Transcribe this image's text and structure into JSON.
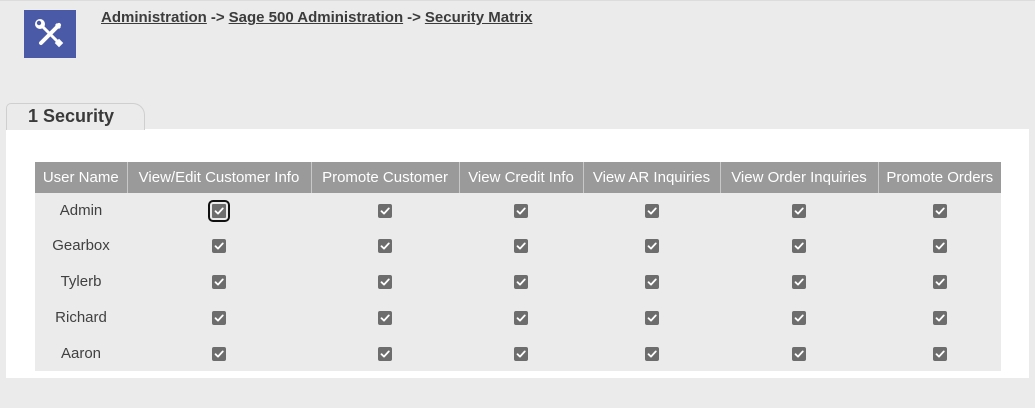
{
  "breadcrumb": {
    "item1": "Administration",
    "sep1": "->",
    "item2": "Sage 500 Administration",
    "sep2": "->",
    "item3": "Security Matrix"
  },
  "tab": {
    "label": "1 Security"
  },
  "icons": {
    "app": "wrench-screwdriver-icon",
    "check": "checkbox-checked-icon"
  },
  "colors": {
    "header": "#9a9a9a",
    "accent": "#4a5aa6",
    "checkbox": "#6d6d6d"
  },
  "table": {
    "headers": [
      "User Name",
      "View/Edit Customer Info",
      "Promote Customer",
      "View Credit Info",
      "View AR Inquiries",
      "View Order Inquiries",
      "Promote Orders"
    ],
    "rows": [
      {
        "user": "Admin",
        "checks": [
          true,
          true,
          true,
          true,
          true,
          true
        ]
      },
      {
        "user": "Gearbox",
        "checks": [
          true,
          true,
          true,
          true,
          true,
          true
        ]
      },
      {
        "user": "Tylerb",
        "checks": [
          true,
          true,
          true,
          true,
          true,
          true
        ]
      },
      {
        "user": "Richard",
        "checks": [
          true,
          true,
          true,
          true,
          true,
          true
        ]
      },
      {
        "user": "Aaron",
        "checks": [
          true,
          true,
          true,
          true,
          true,
          true
        ]
      }
    ]
  }
}
